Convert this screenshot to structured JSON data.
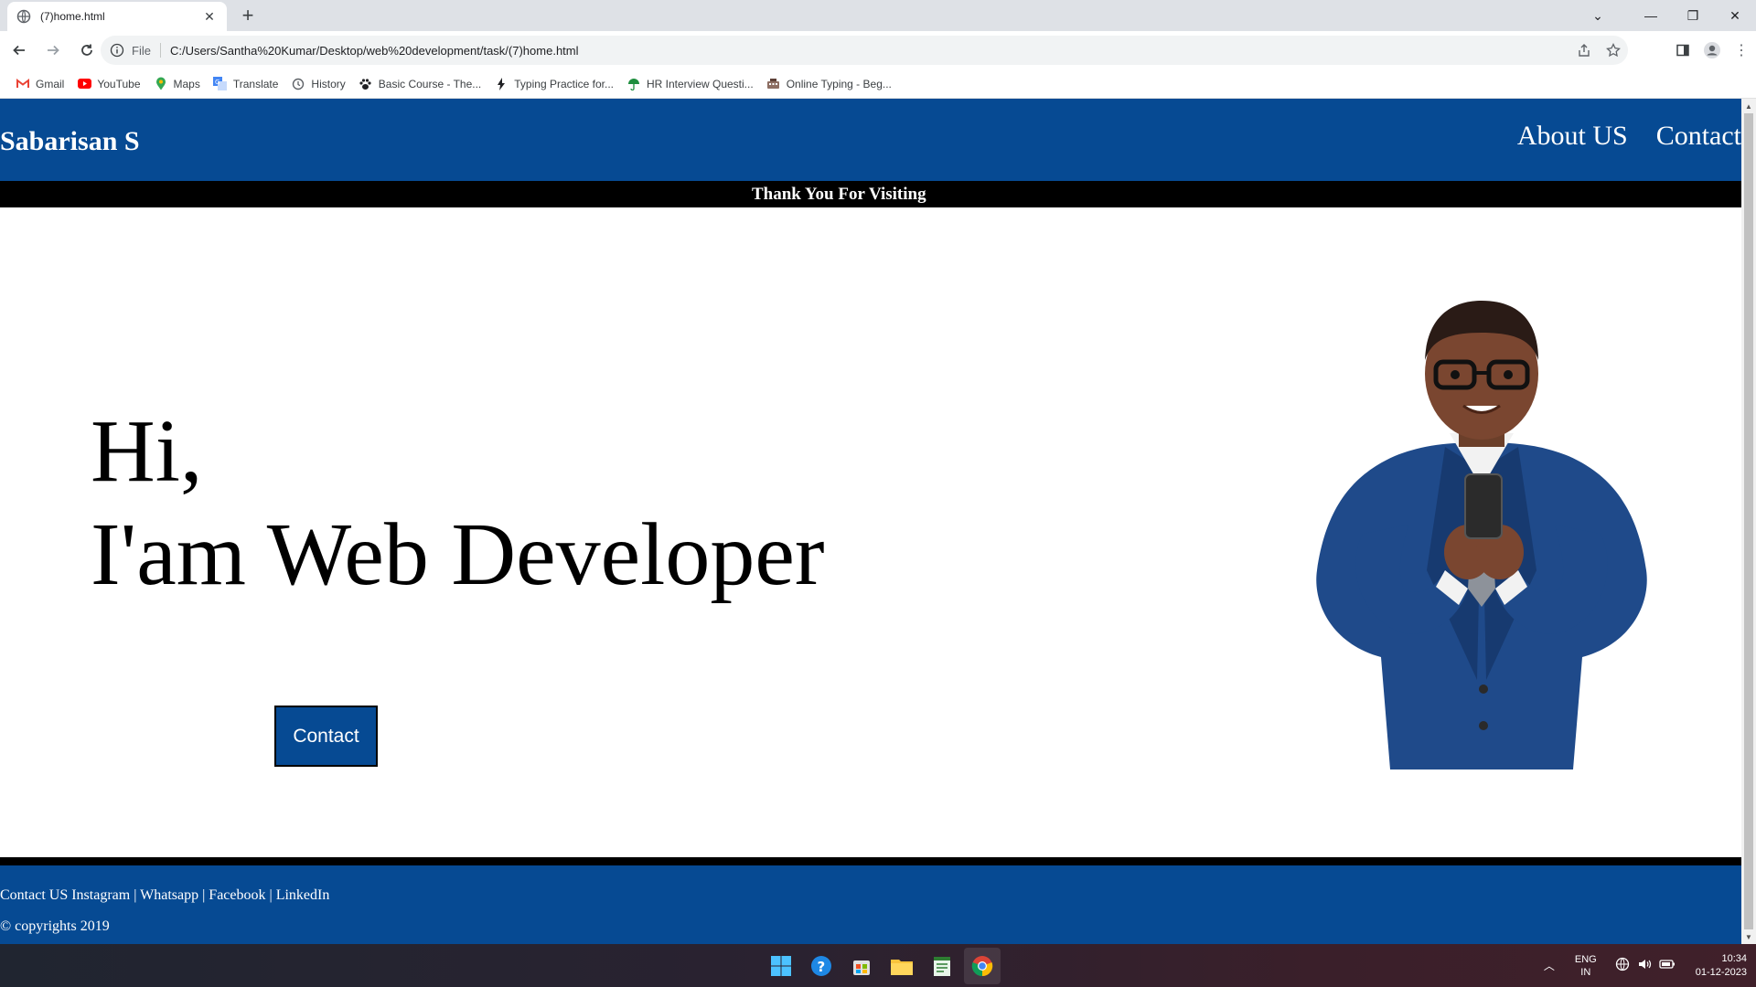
{
  "browser": {
    "tab_title": "(7)home.html",
    "scheme_label": "File",
    "url": "C:/Users/Santha%20Kumar/Desktop/web%20development/task/(7)home.html",
    "bookmarks": [
      {
        "label": "Gmail",
        "icon": "gmail-icon"
      },
      {
        "label": "YouTube",
        "icon": "youtube-icon"
      },
      {
        "label": "Maps",
        "icon": "maps-icon"
      },
      {
        "label": "Translate",
        "icon": "translate-icon"
      },
      {
        "label": "History",
        "icon": "history-icon"
      },
      {
        "label": "Basic Course - The...",
        "icon": "paw-icon"
      },
      {
        "label": "Typing Practice for...",
        "icon": "bolt-icon"
      },
      {
        "label": "HR Interview Questi...",
        "icon": "umbrella-icon"
      },
      {
        "label": "Online Typing - Beg...",
        "icon": "keyboard-icon"
      }
    ]
  },
  "site": {
    "brand": "Sabarisan S",
    "nav": [
      "About US",
      "Contact"
    ],
    "marquee": "Thank You For Visiting",
    "hero_line1": "Hi,",
    "hero_line2": "I'am Web Developer",
    "cta": "Contact",
    "footer_links": "Contact US Instagram | Whatsapp | Facebook | LinkedIn",
    "copyright": "© copyrights 2019"
  },
  "taskbar": {
    "lang_line1": "ENG",
    "lang_line2": "IN",
    "time": "10:34",
    "date": "01-12-2023"
  },
  "colors": {
    "brand_blue": "#064a93",
    "black_bar": "#000000"
  }
}
